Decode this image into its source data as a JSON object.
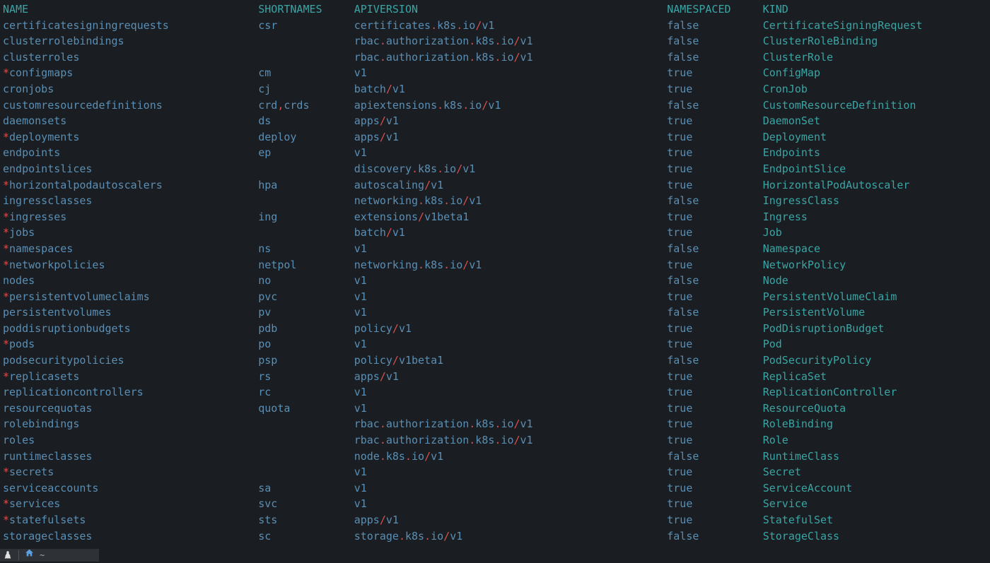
{
  "headers": {
    "name": "NAME",
    "short": "SHORTNAMES",
    "api": "APIVERSION",
    "ns": "NAMESPACED",
    "kind": "KIND"
  },
  "rows": [
    {
      "star": false,
      "name": "certificatesigningrequests",
      "short": "csr",
      "api": [
        {
          "t": "certificates",
          "s": 0
        },
        {
          "t": ".",
          "s": 1
        },
        {
          "t": "k8s",
          "s": 0
        },
        {
          "t": ".",
          "s": 1
        },
        {
          "t": "io",
          "s": 0
        },
        {
          "t": "/",
          "s": 1
        },
        {
          "t": "v1",
          "s": 0
        }
      ],
      "ns": "false",
      "kind": "CertificateSigningRequest"
    },
    {
      "star": false,
      "name": "clusterrolebindings",
      "short": "",
      "api": [
        {
          "t": "rbac",
          "s": 0
        },
        {
          "t": ".",
          "s": 1
        },
        {
          "t": "authorization",
          "s": 0
        },
        {
          "t": ".",
          "s": 1
        },
        {
          "t": "k8s",
          "s": 0
        },
        {
          "t": ".",
          "s": 1
        },
        {
          "t": "io",
          "s": 0
        },
        {
          "t": "/",
          "s": 1
        },
        {
          "t": "v1",
          "s": 0
        }
      ],
      "ns": "false",
      "kind": "ClusterRoleBinding"
    },
    {
      "star": false,
      "name": "clusterroles",
      "short": "",
      "api": [
        {
          "t": "rbac",
          "s": 0
        },
        {
          "t": ".",
          "s": 1
        },
        {
          "t": "authorization",
          "s": 0
        },
        {
          "t": ".",
          "s": 1
        },
        {
          "t": "k8s",
          "s": 0
        },
        {
          "t": ".",
          "s": 1
        },
        {
          "t": "io",
          "s": 0
        },
        {
          "t": "/",
          "s": 1
        },
        {
          "t": "v1",
          "s": 0
        }
      ],
      "ns": "false",
      "kind": "ClusterRole"
    },
    {
      "star": true,
      "name": "configmaps",
      "short": "cm",
      "api": [
        {
          "t": "v1",
          "s": 0
        }
      ],
      "ns": "true",
      "kind": "ConfigMap"
    },
    {
      "star": false,
      "name": "cronjobs",
      "short": "cj",
      "api": [
        {
          "t": "batch",
          "s": 0
        },
        {
          "t": "/",
          "s": 1
        },
        {
          "t": "v1",
          "s": 0
        }
      ],
      "ns": "true",
      "kind": "CronJob"
    },
    {
      "star": false,
      "name": "customresourcedefinitions",
      "short_parts": [
        {
          "t": "crd",
          "s": 0
        },
        {
          "t": ",",
          "s": 1
        },
        {
          "t": "crds",
          "s": 0
        }
      ],
      "api": [
        {
          "t": "apiextensions",
          "s": 0
        },
        {
          "t": ".",
          "s": 1
        },
        {
          "t": "k8s",
          "s": 0
        },
        {
          "t": ".",
          "s": 1
        },
        {
          "t": "io",
          "s": 0
        },
        {
          "t": "/",
          "s": 1
        },
        {
          "t": "v1",
          "s": 0
        }
      ],
      "ns": "false",
      "kind": "CustomResourceDefinition"
    },
    {
      "star": false,
      "name": "daemonsets",
      "short": "ds",
      "api": [
        {
          "t": "apps",
          "s": 0
        },
        {
          "t": "/",
          "s": 1
        },
        {
          "t": "v1",
          "s": 0
        }
      ],
      "ns": "true",
      "kind": "DaemonSet"
    },
    {
      "star": true,
      "name": "deployments",
      "short": "deploy",
      "api": [
        {
          "t": "apps",
          "s": 0
        },
        {
          "t": "/",
          "s": 1
        },
        {
          "t": "v1",
          "s": 0
        }
      ],
      "ns": "true",
      "kind": "Deployment"
    },
    {
      "star": false,
      "name": "endpoints",
      "short": "ep",
      "api": [
        {
          "t": "v1",
          "s": 0
        }
      ],
      "ns": "true",
      "kind": "Endpoints"
    },
    {
      "star": false,
      "name": "endpointslices",
      "short": "",
      "api": [
        {
          "t": "discovery",
          "s": 0
        },
        {
          "t": ".",
          "s": 1
        },
        {
          "t": "k8s",
          "s": 0
        },
        {
          "t": ".",
          "s": 1
        },
        {
          "t": "io",
          "s": 0
        },
        {
          "t": "/",
          "s": 1
        },
        {
          "t": "v1",
          "s": 0
        }
      ],
      "ns": "true",
      "kind": "EndpointSlice"
    },
    {
      "star": true,
      "name": "horizontalpodautoscalers",
      "short": "hpa",
      "api": [
        {
          "t": "autoscaling",
          "s": 0
        },
        {
          "t": "/",
          "s": 1
        },
        {
          "t": "v1",
          "s": 0
        }
      ],
      "ns": "true",
      "kind": "HorizontalPodAutoscaler"
    },
    {
      "star": false,
      "name": "ingressclasses",
      "short": "",
      "api": [
        {
          "t": "networking",
          "s": 0
        },
        {
          "t": ".",
          "s": 1
        },
        {
          "t": "k8s",
          "s": 0
        },
        {
          "t": ".",
          "s": 1
        },
        {
          "t": "io",
          "s": 0
        },
        {
          "t": "/",
          "s": 1
        },
        {
          "t": "v1",
          "s": 0
        }
      ],
      "ns": "false",
      "kind": "IngressClass"
    },
    {
      "star": true,
      "name": "ingresses",
      "short": "ing",
      "api": [
        {
          "t": "extensions",
          "s": 0
        },
        {
          "t": "/",
          "s": 1
        },
        {
          "t": "v1beta1",
          "s": 0
        }
      ],
      "ns": "true",
      "kind": "Ingress"
    },
    {
      "star": true,
      "name": "jobs",
      "short": "",
      "api": [
        {
          "t": "batch",
          "s": 0
        },
        {
          "t": "/",
          "s": 1
        },
        {
          "t": "v1",
          "s": 0
        }
      ],
      "ns": "true",
      "kind": "Job"
    },
    {
      "star": true,
      "name": "namespaces",
      "short": "ns",
      "api": [
        {
          "t": "v1",
          "s": 0
        }
      ],
      "ns": "false",
      "kind": "Namespace"
    },
    {
      "star": true,
      "name": "networkpolicies",
      "short": "netpol",
      "api": [
        {
          "t": "networking",
          "s": 0
        },
        {
          "t": ".",
          "s": 1
        },
        {
          "t": "k8s",
          "s": 0
        },
        {
          "t": ".",
          "s": 1
        },
        {
          "t": "io",
          "s": 0
        },
        {
          "t": "/",
          "s": 1
        },
        {
          "t": "v1",
          "s": 0
        }
      ],
      "ns": "true",
      "kind": "NetworkPolicy"
    },
    {
      "star": false,
      "name": "nodes",
      "short": "no",
      "api": [
        {
          "t": "v1",
          "s": 0
        }
      ],
      "ns": "false",
      "kind": "Node"
    },
    {
      "star": true,
      "name": "persistentvolumeclaims",
      "short": "pvc",
      "api": [
        {
          "t": "v1",
          "s": 0
        }
      ],
      "ns": "true",
      "kind": "PersistentVolumeClaim"
    },
    {
      "star": false,
      "name": "persistentvolumes",
      "short": "pv",
      "api": [
        {
          "t": "v1",
          "s": 0
        }
      ],
      "ns": "false",
      "kind": "PersistentVolume"
    },
    {
      "star": false,
      "name": "poddisruptionbudgets",
      "short": "pdb",
      "api": [
        {
          "t": "policy",
          "s": 0
        },
        {
          "t": "/",
          "s": 1
        },
        {
          "t": "v1",
          "s": 0
        }
      ],
      "ns": "true",
      "kind": "PodDisruptionBudget"
    },
    {
      "star": true,
      "name": "pods",
      "short": "po",
      "api": [
        {
          "t": "v1",
          "s": 0
        }
      ],
      "ns": "true",
      "kind": "Pod"
    },
    {
      "star": false,
      "name": "podsecuritypolicies",
      "short": "psp",
      "api": [
        {
          "t": "policy",
          "s": 0
        },
        {
          "t": "/",
          "s": 1
        },
        {
          "t": "v1beta1",
          "s": 0
        }
      ],
      "ns": "false",
      "kind": "PodSecurityPolicy"
    },
    {
      "star": true,
      "name": "replicasets",
      "short": "rs",
      "api": [
        {
          "t": "apps",
          "s": 0
        },
        {
          "t": "/",
          "s": 1
        },
        {
          "t": "v1",
          "s": 0
        }
      ],
      "ns": "true",
      "kind": "ReplicaSet"
    },
    {
      "star": false,
      "name": "replicationcontrollers",
      "short": "rc",
      "api": [
        {
          "t": "v1",
          "s": 0
        }
      ],
      "ns": "true",
      "kind": "ReplicationController"
    },
    {
      "star": false,
      "name": "resourcequotas",
      "short": "quota",
      "api": [
        {
          "t": "v1",
          "s": 0
        }
      ],
      "ns": "true",
      "kind": "ResourceQuota"
    },
    {
      "star": false,
      "name": "rolebindings",
      "short": "",
      "api": [
        {
          "t": "rbac",
          "s": 0
        },
        {
          "t": ".",
          "s": 1
        },
        {
          "t": "authorization",
          "s": 0
        },
        {
          "t": ".",
          "s": 1
        },
        {
          "t": "k8s",
          "s": 0
        },
        {
          "t": ".",
          "s": 1
        },
        {
          "t": "io",
          "s": 0
        },
        {
          "t": "/",
          "s": 1
        },
        {
          "t": "v1",
          "s": 0
        }
      ],
      "ns": "true",
      "kind": "RoleBinding"
    },
    {
      "star": false,
      "name": "roles",
      "short": "",
      "api": [
        {
          "t": "rbac",
          "s": 0
        },
        {
          "t": ".",
          "s": 1
        },
        {
          "t": "authorization",
          "s": 0
        },
        {
          "t": ".",
          "s": 1
        },
        {
          "t": "k8s",
          "s": 0
        },
        {
          "t": ".",
          "s": 1
        },
        {
          "t": "io",
          "s": 0
        },
        {
          "t": "/",
          "s": 1
        },
        {
          "t": "v1",
          "s": 0
        }
      ],
      "ns": "true",
      "kind": "Role"
    },
    {
      "star": false,
      "name": "runtimeclasses",
      "short": "",
      "api": [
        {
          "t": "node",
          "s": 0
        },
        {
          "t": ".",
          "s": 1
        },
        {
          "t": "k8s",
          "s": 0
        },
        {
          "t": ".",
          "s": 1
        },
        {
          "t": "io",
          "s": 0
        },
        {
          "t": "/",
          "s": 1
        },
        {
          "t": "v1",
          "s": 0
        }
      ],
      "ns": "false",
      "kind": "RuntimeClass"
    },
    {
      "star": true,
      "name": "secrets",
      "short": "",
      "api": [
        {
          "t": "v1",
          "s": 0
        }
      ],
      "ns": "true",
      "kind": "Secret"
    },
    {
      "star": false,
      "name": "serviceaccounts",
      "short": "sa",
      "api": [
        {
          "t": "v1",
          "s": 0
        }
      ],
      "ns": "true",
      "kind": "ServiceAccount"
    },
    {
      "star": true,
      "name": "services",
      "short": "svc",
      "api": [
        {
          "t": "v1",
          "s": 0
        }
      ],
      "ns": "true",
      "kind": "Service"
    },
    {
      "star": true,
      "name": "statefulsets",
      "short": "sts",
      "api": [
        {
          "t": "apps",
          "s": 0
        },
        {
          "t": "/",
          "s": 1
        },
        {
          "t": "v1",
          "s": 0
        }
      ],
      "ns": "true",
      "kind": "StatefulSet"
    },
    {
      "star": false,
      "name": "storageclasses",
      "short": "sc",
      "api": [
        {
          "t": "storage",
          "s": 0
        },
        {
          "t": ".",
          "s": 1
        },
        {
          "t": "k8s",
          "s": 0
        },
        {
          "t": ".",
          "s": 1
        },
        {
          "t": "io",
          "s": 0
        },
        {
          "t": "/",
          "s": 1
        },
        {
          "t": "v1",
          "s": 0
        }
      ],
      "ns": "false",
      "kind": "StorageClass"
    }
  ],
  "cols": {
    "name": 40,
    "short": 15,
    "api": 49,
    "ns": 15
  },
  "taskbar": {
    "tilde": "~",
    "home_glyph": "⌂"
  }
}
